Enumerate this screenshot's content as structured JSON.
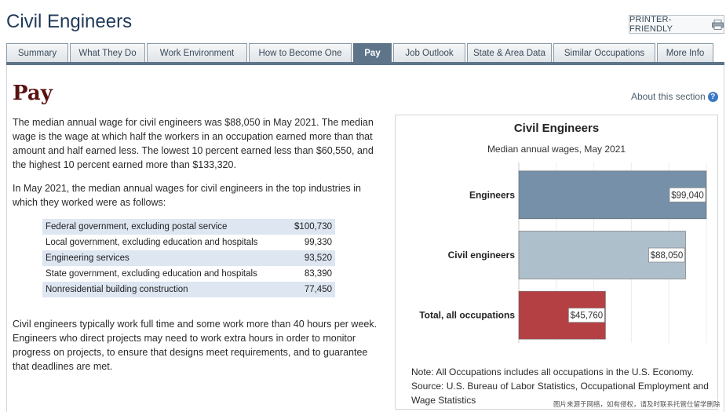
{
  "page": {
    "title": "Civil Engineers",
    "printer_label": "PRINTER-FRIENDLY"
  },
  "tabs": [
    {
      "label": "Summary"
    },
    {
      "label": "What They Do"
    },
    {
      "label": "Work Environment"
    },
    {
      "label": "How to Become One"
    },
    {
      "label": "Pay",
      "active": true
    },
    {
      "label": "Job Outlook"
    },
    {
      "label": "State & Area Data"
    },
    {
      "label": "Similar Occupations"
    },
    {
      "label": "More Info"
    }
  ],
  "section": {
    "heading": "Pay",
    "about_label": "About this section",
    "paragraph1": "The median annual wage for civil engineers was $88,050 in May 2021. The median wage is the wage at which half the workers in an occupation earned more than that amount and half earned less. The lowest 10 percent earned less than $60,550, and the highest 10 percent earned more than $133,320.",
    "paragraph2": "In May 2021, the median annual wages for civil engineers in the top industries in which they worked were as follows:",
    "paragraph3": "Civil engineers typically work full time and some work more than 40 hours per week. Engineers who direct projects may need to work extra hours in order to monitor progress on projects, to ensure that designs meet requirements, and to guarantee that deadlines are met."
  },
  "industries": [
    {
      "name": "Federal government, excluding postal service",
      "wage": "$100,730"
    },
    {
      "name": "Local government, excluding education and hospitals",
      "wage": "99,330"
    },
    {
      "name": "Engineering services",
      "wage": "93,520"
    },
    {
      "name": "State government, excluding education and hospitals",
      "wage": "83,390"
    },
    {
      "name": "Nonresidential building construction",
      "wage": "77,450"
    }
  ],
  "chart_data": {
    "type": "bar",
    "orientation": "horizontal",
    "title": "Civil Engineers",
    "subtitle": "Median annual wages, May 2021",
    "categories": [
      "Engineers",
      "Civil engineers",
      "Total, all occupations"
    ],
    "values": [
      99040,
      88050,
      45760
    ],
    "data_labels": [
      "$99,040",
      "$88,050",
      "$45,760"
    ],
    "colors": [
      "#7590a8",
      "#aebfcc",
      "#b54043"
    ],
    "xlim": [
      0,
      99040
    ],
    "grid": true,
    "note_line1": "Note: All Occupations includes all occupations in the U.S. Economy.",
    "note_line2": "Source: U.S. Bureau of Labor Statistics, Occupational Employment and Wage Statistics"
  },
  "watermark": "图片来源于网络，如有侵权，请及时联系托管仕留学删除"
}
